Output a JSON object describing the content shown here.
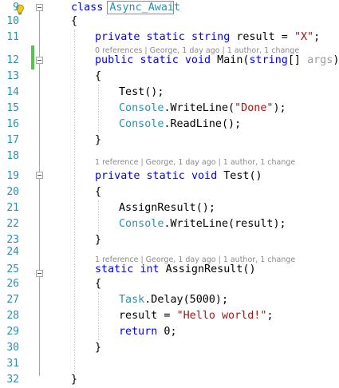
{
  "code_lines": [
    {
      "n": "9",
      "tokens": [
        {
          "t": "kw",
          "v": "class"
        },
        {
          "t": "plain",
          "v": " "
        },
        {
          "t": "ty",
          "v": "Async_Await"
        }
      ]
    },
    {
      "n": "10",
      "tokens": [
        {
          "t": "plain",
          "v": "{"
        }
      ]
    },
    {
      "n": "11",
      "tokens": [
        {
          "t": "kw",
          "v": "private"
        },
        {
          "t": "plain",
          "v": " "
        },
        {
          "t": "kw",
          "v": "static"
        },
        {
          "t": "plain",
          "v": " "
        },
        {
          "t": "kw",
          "v": "string"
        },
        {
          "t": "plain",
          "v": " result = "
        },
        {
          "t": "st",
          "v": "\"X\""
        },
        {
          "t": "plain",
          "v": ";"
        }
      ]
    },
    {
      "n": "12",
      "tokens": [
        {
          "t": "kw",
          "v": "public"
        },
        {
          "t": "plain",
          "v": " "
        },
        {
          "t": "kw",
          "v": "static"
        },
        {
          "t": "plain",
          "v": " "
        },
        {
          "t": "kw",
          "v": "void"
        },
        {
          "t": "plain",
          "v": " Main("
        },
        {
          "t": "kw",
          "v": "string"
        },
        {
          "t": "plain",
          "v": "[] "
        },
        {
          "t": "dim",
          "v": "args"
        },
        {
          "t": "plain",
          "v": ")"
        }
      ]
    },
    {
      "n": "13",
      "tokens": [
        {
          "t": "plain",
          "v": "{"
        }
      ]
    },
    {
      "n": "14",
      "tokens": [
        {
          "t": "plain",
          "v": "Test();"
        }
      ]
    },
    {
      "n": "15",
      "tokens": [
        {
          "t": "ty",
          "v": "Console"
        },
        {
          "t": "plain",
          "v": ".WriteLine("
        },
        {
          "t": "st",
          "v": "\"Done\""
        },
        {
          "t": "plain",
          "v": ");"
        }
      ]
    },
    {
      "n": "16",
      "tokens": [
        {
          "t": "ty",
          "v": "Console"
        },
        {
          "t": "plain",
          "v": ".ReadLine();"
        }
      ]
    },
    {
      "n": "17",
      "tokens": [
        {
          "t": "plain",
          "v": "}"
        }
      ]
    },
    {
      "n": "18",
      "tokens": []
    },
    {
      "n": "19",
      "tokens": [
        {
          "t": "kw",
          "v": "private"
        },
        {
          "t": "plain",
          "v": " "
        },
        {
          "t": "kw",
          "v": "static"
        },
        {
          "t": "plain",
          "v": " "
        },
        {
          "t": "kw",
          "v": "void"
        },
        {
          "t": "plain",
          "v": " Test()"
        }
      ]
    },
    {
      "n": "20",
      "tokens": [
        {
          "t": "plain",
          "v": "{"
        }
      ]
    },
    {
      "n": "21",
      "tokens": [
        {
          "t": "plain",
          "v": "AssignResult();"
        }
      ]
    },
    {
      "n": "22",
      "tokens": [
        {
          "t": "ty",
          "v": "Console"
        },
        {
          "t": "plain",
          "v": ".WriteLine(result);"
        }
      ]
    },
    {
      "n": "23",
      "tokens": [
        {
          "t": "plain",
          "v": "}"
        }
      ]
    },
    {
      "n": "24",
      "tokens": []
    },
    {
      "n": "25",
      "tokens": [
        {
          "t": "kw",
          "v": "static"
        },
        {
          "t": "plain",
          "v": " "
        },
        {
          "t": "kw",
          "v": "int"
        },
        {
          "t": "plain",
          "v": " AssignResult()"
        }
      ]
    },
    {
      "n": "26",
      "tokens": [
        {
          "t": "plain",
          "v": "{"
        }
      ]
    },
    {
      "n": "27",
      "tokens": [
        {
          "t": "ty",
          "v": "Task"
        },
        {
          "t": "plain",
          "v": ".Delay(5000);"
        }
      ]
    },
    {
      "n": "28",
      "tokens": [
        {
          "t": "plain",
          "v": "result = "
        },
        {
          "t": "st",
          "v": "\"Hello world!\""
        },
        {
          "t": "plain",
          "v": ";"
        }
      ]
    },
    {
      "n": "29",
      "tokens": [
        {
          "t": "kw",
          "v": "return"
        },
        {
          "t": "plain",
          "v": " 0;"
        }
      ]
    },
    {
      "n": "30",
      "tokens": [
        {
          "t": "plain",
          "v": "}"
        }
      ]
    },
    {
      "n": "31",
      "tokens": []
    },
    {
      "n": "32",
      "tokens": [
        {
          "t": "plain",
          "v": "}"
        }
      ]
    }
  ],
  "codelens": [
    "0 references | George, 1 day ago | 1 author, 1 change",
    "1 reference | George, 1 day ago | 1 author, 1 change",
    "1 reference | George, 1 day ago | 1 author, 1 change"
  ],
  "colors": {
    "keyword": "#0000ff",
    "type": "#2b91af",
    "string": "#a31515",
    "line_number": "#2b91af",
    "change_marker": "#57c254",
    "lightbulb": "#f2c811"
  },
  "icons": [
    "lightbulb-icon",
    "collapse-icon"
  ]
}
